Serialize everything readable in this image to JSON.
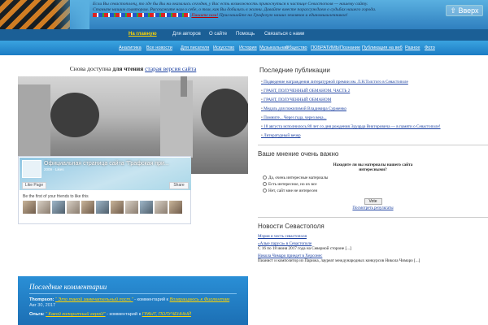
{
  "header": {
    "intro_text": "Если Вы севастополец, то где бы Вы ни оказались сегодня, у Вас есть возможность прикоснуться к частице Севастополя — нашему сайту. Станьте нашим соавтором. Расскажите нам о себе, о том, как Вы добились в жизни. Давайте вместе порассуждаем о судьбах нашего города.",
    "intro_link": "Пишите нам!",
    "intro_tail": "Приглашайте на Графскую наших земляков и единомышленников!",
    "up_button": "⇧ Вверх"
  },
  "nav_main": [
    {
      "label": "На главную",
      "active": true
    },
    {
      "label": "Для авторов",
      "active": false
    },
    {
      "label": "О сайте",
      "active": false
    },
    {
      "label": "Помощь",
      "active": false
    },
    {
      "label": "Связаться с нами",
      "active": false
    }
  ],
  "nav_categories": [
    "Аналитика",
    "Все новости",
    "Для писателя",
    "Искусство",
    "История",
    "Музыкальная",
    "Общество",
    "ПОБРАТИМЫ",
    "Познание",
    "Публикация на веб",
    "Разное",
    "Фото"
  ],
  "main": {
    "notice_prefix": "Снова доступна",
    "notice_bold": "для чтения",
    "notice_link": "старая версия сайта"
  },
  "facebook": {
    "page_title": "Официальная страница сайта \"Графская при...",
    "page_sub": "2009 · Likes",
    "like_label": "Like Page",
    "share_label": "Share",
    "friends_text": "Be the first of your friends to like this"
  },
  "comments": {
    "title": "Последние комментарии",
    "items": [
      {
        "author": "Thompson:",
        "quote": "“ Это такой замечательный пост.”",
        "middle": "- комментарий к",
        "link": "Возвращаюсь к Фиолентам",
        "date": "Авг 30, 2017"
      },
      {
        "author": "Ольга:",
        "quote": "“ Какой колоритный герой!”",
        "middle": "- комментарий к",
        "link": "ГРАНТ, ПОЛУЧЕННЫЙ",
        "date": ""
      }
    ]
  },
  "sidebar": {
    "pubs_title": "Последние публикации",
    "pubs": [
      "Подведение награждения литературной премии им. Л.Н.Толстого в Севастополе",
      "ГРАНТ, ПОЛУЧЕННЫЙ ОБМАНОМ. ЧАСТЬ 2",
      "ГРАНТ, ПОЛУЧЕННЫЙ ОБМАНОМ",
      "Медаль для пожилимой Владимира Сурженко",
      "Помните... Через года, через века...",
      "18 августа исполнилось 80 лет со дня рождения Эдуарда Викторовича — в памяти о Севастополе!",
      "Литературный вечер"
    ],
    "poll_title": "Ваше мнение очень важно",
    "poll_question": "Находите ли вы материалы нашего сайта интересными?",
    "poll_options": [
      "Да, очень интересные материалы",
      "Есть интересное, но их все",
      "Нет, сайт мне не интересен"
    ],
    "vote_label": "Vote",
    "results_link": "Посмотреть результаты",
    "news_title": "Новости Севастополя",
    "news": [
      {
        "link": "Мэрия и честь севастополя",
        "text": ""
      },
      {
        "link": "«Алые паруса» в Севастополе",
        "text": "С 16 по 18 июня 2017 года на Северной стороне [...]"
      },
      {
        "link": "Никола Чимаро приедет в Херсонес",
        "text": "Пианист и композитор из Парижа, лауреат международных конкурсов Никола Чимаро [...]"
      }
    ]
  }
}
